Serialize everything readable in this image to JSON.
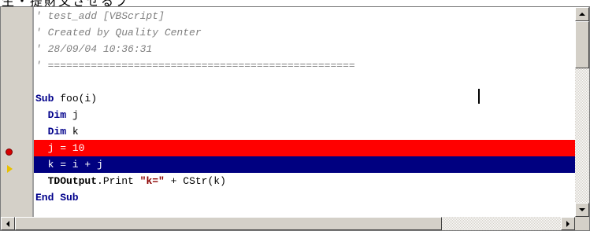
{
  "top_text": "生・提財文させるプ",
  "editor": {
    "lines": [
      "' test_add [VBScript]",
      "' Created by Quality Center",
      "' 28/09/04 10:36:31",
      "' ==================================================",
      "",
      "foo(i)",
      "j",
      "k",
      "  j = 10",
      "  k = i + j",
      ".Print ",
      "End Sub"
    ],
    "keywords": {
      "sub": "Sub",
      "dim": "Dim",
      "end_sub": "End Sub"
    },
    "print_line": {
      "object": "TDOutput",
      "method": ".Print ",
      "string": "\"k=\"",
      "rest": " + CStr(k)"
    }
  },
  "markers": {
    "breakpoint_line": 9,
    "current_line": 10
  },
  "colors": {
    "breakpoint_bg": "#ff0000",
    "current_bg": "#000080",
    "keyword": "#00008b",
    "string": "#8b0000",
    "comment": "#808080"
  }
}
